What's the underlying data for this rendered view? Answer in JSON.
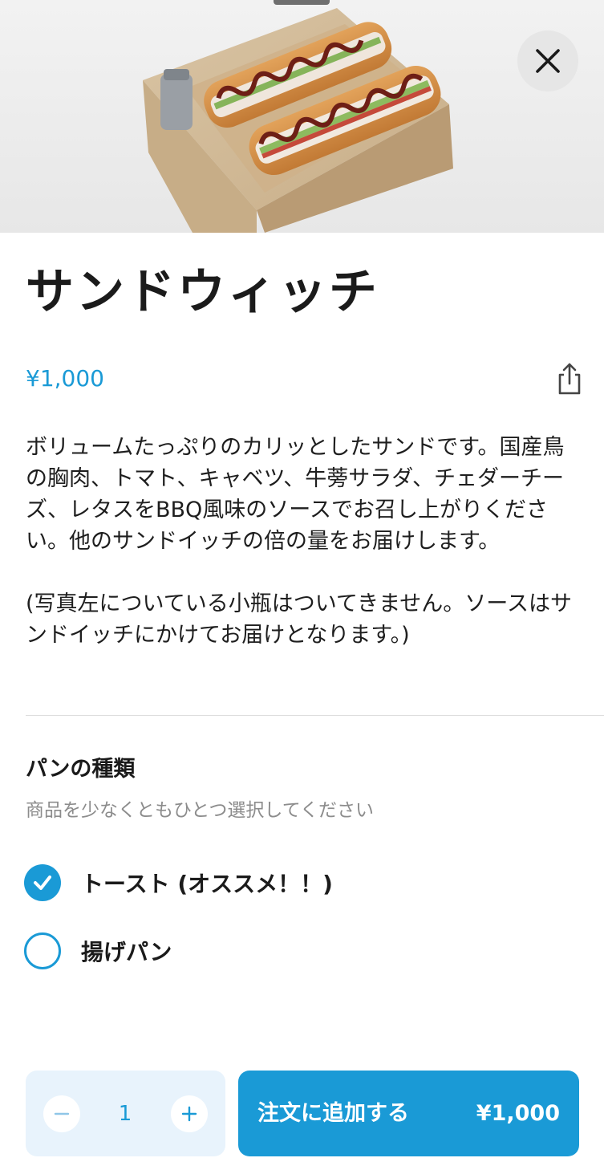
{
  "product": {
    "title": "サンドウィッチ",
    "price": "¥1,000",
    "description": "ボリュームたっぷりのカリッとしたサンドです。国産鳥の胸肉、トマト、キャベツ、牛蒡サラダ、チェダーチーズ、レタスをBBQ風味のソースでお召し上がりください。他のサンドイッチの倍の量をお届けします。\n\n(写真左についている小瓶はついてきません。ソースはサンドイッチにかけてお届けとなります。)"
  },
  "options": {
    "title": "パンの種類",
    "subtitle": "商品を少なくともひとつ選択してください",
    "items": [
      {
        "label": "トースト (オススメ！！)",
        "selected": true
      },
      {
        "label": "揚げパン",
        "selected": false
      }
    ]
  },
  "cart": {
    "quantity": "1",
    "add_label": "注文に追加する",
    "total": "¥1,000"
  },
  "icons": {
    "close": "close-icon",
    "share": "share-icon",
    "minus": "minus-icon",
    "plus": "plus-icon",
    "check": "check-icon"
  },
  "colors": {
    "accent": "#1a9ad6",
    "quantity_bg": "#e8f3fc",
    "close_bg": "#e6e6e6",
    "subtitle": "#8c8c8c"
  }
}
